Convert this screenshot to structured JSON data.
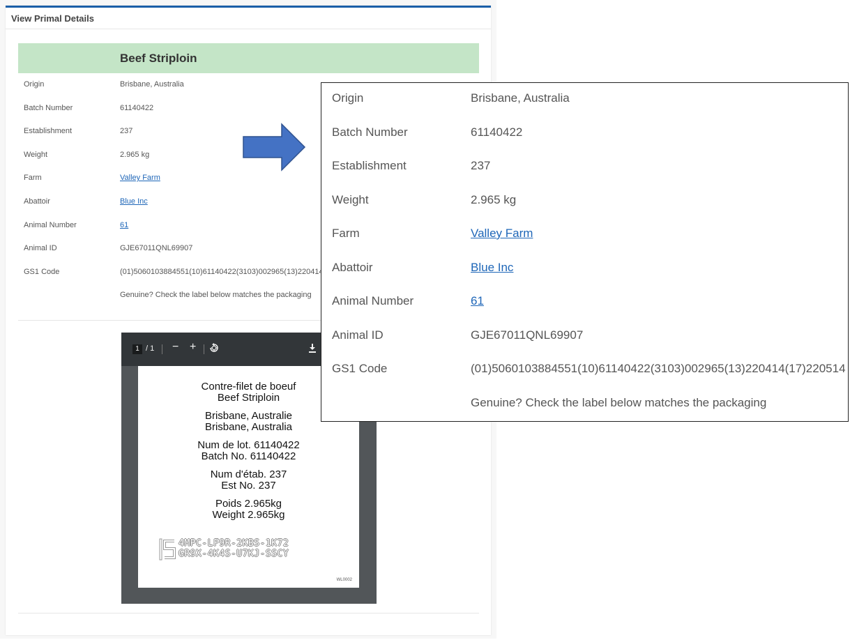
{
  "panel": {
    "title": "View Primal Details",
    "product_name": "Beef Striploin",
    "rows": [
      {
        "label": "Origin",
        "value": "Brisbane, Australia",
        "link": false
      },
      {
        "label": "Batch Number",
        "value": "61140422",
        "link": false
      },
      {
        "label": "Establishment",
        "value": "237",
        "link": false
      },
      {
        "label": "Weight",
        "value": "2.965 kg",
        "link": false
      },
      {
        "label": "Farm",
        "value": "Valley Farm",
        "link": true
      },
      {
        "label": "Abattoir",
        "value": "Blue Inc",
        "link": true
      },
      {
        "label": "Animal Number",
        "value": "61",
        "link": true
      },
      {
        "label": "Animal ID",
        "value": "GJE67011QNL69907",
        "link": false
      },
      {
        "label": "GS1 Code",
        "value": "(01)5060103884551(10)61140422(3103)002965(13)220414(17)220514",
        "link": false
      },
      {
        "label": "",
        "value": "Genuine? Check the label below matches the packaging",
        "link": false
      }
    ]
  },
  "pdf_viewer": {
    "current_page": "1",
    "page_count": "/ 1",
    "zoom_out_icon": "minus-icon",
    "zoom_in_icon": "plus-icon",
    "rotate_icon": "rotate-icon",
    "download_icon": "download-icon",
    "label": {
      "lines": [
        [
          "Contre-filet de boeuf",
          "Beef Striploin"
        ],
        [
          "Brisbane, Australie",
          "Brisbane, Australia"
        ],
        [
          "Num de lot. 61140422",
          "Batch No. 61140422"
        ],
        [
          "Num d'étab. 237",
          "Est No. 237"
        ],
        [
          "Poids 2.965kg",
          "Weight 2.965kg"
        ]
      ],
      "code_line1": "4MPC-LF9R-2KBS-1K72",
      "code_line2": "GR9X-4K4S-U7KJ-SSCY",
      "footer": "WL0002"
    }
  },
  "colors": {
    "accent": "#1a5fa8",
    "header_bar": "#c4e5c7",
    "link": "#1e66b8",
    "arrow": "#4472c4"
  }
}
